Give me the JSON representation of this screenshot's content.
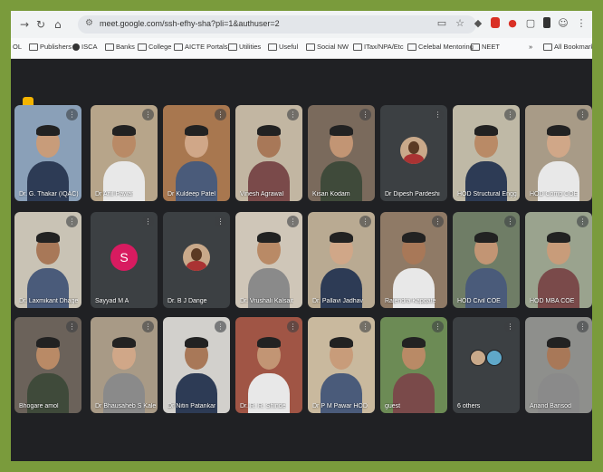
{
  "browser": {
    "url": "meet.google.com/ssh-efhy-sha?pli=1&authuser=2",
    "bookmarks": [
      "Publishers",
      "ISCA",
      "Banks",
      "College",
      "AICTE Portals",
      "Utilities",
      "Useful",
      "Social NW",
      "ITax/NPA/Etc",
      "Celebal Mentoring",
      "NEET"
    ],
    "all_bookmarks_label": "All Bookmarks"
  },
  "meeting": {
    "participants": [
      {
        "name": "Dr. G. Thakar (IQAC)",
        "bg": "#8aa0b8"
      },
      {
        "name": "Dr Anil Pawar",
        "bg": "#b7a58a"
      },
      {
        "name": "Dr Kuldeep Patel",
        "bg": "#a8774f"
      },
      {
        "name": "Vinesh Agrawal",
        "bg": "#c2b6a2"
      },
      {
        "name": "Kisan Kodam",
        "bg": "#7a6a5c"
      },
      {
        "name": "Dr Dipesh Pardeshi",
        "bg": "#3c4043",
        "avatar": "photo"
      },
      {
        "name": "HOD Structural Engg",
        "bg": "#bfb9a6"
      },
      {
        "name": "HOD Comp COE",
        "bg": "#a89b87"
      },
      {
        "name": "Dr. Laxmikant Dhage",
        "bg": "#c9c3b5"
      },
      {
        "name": "Sayyad M A",
        "bg": "#3c4043",
        "avatar": "S",
        "avatar_color": "#d81b60"
      },
      {
        "name": "Dr. B J Dange",
        "bg": "#3c4043",
        "avatar": "photo"
      },
      {
        "name": "Dr. Vrushali Kalsait",
        "bg": "#cfc6b8"
      },
      {
        "name": "Dr. Pallavi Jadhav",
        "bg": "#b9aa92"
      },
      {
        "name": "Rajendra Kapgate",
        "bg": "#8f7a66"
      },
      {
        "name": "HOD Civil COE",
        "bg": "#6f7d66"
      },
      {
        "name": "HOD MBA COE",
        "bg": "#9aa38e"
      },
      {
        "name": "Bhogare amol",
        "bg": "#6b625a"
      },
      {
        "name": "Dr Bhausaheb S Kale",
        "bg": "#a89a86"
      },
      {
        "name": "Dr Nitin Patankar",
        "bg": "#d2d0cc"
      },
      {
        "name": "Dr. R. R. Shinde",
        "bg": "#a05545"
      },
      {
        "name": "Dr P M Pawar HOD",
        "bg": "#c9b99e"
      },
      {
        "name": "guest",
        "bg": "#6c8b55"
      },
      {
        "name": "6 others",
        "bg": "#3c4043",
        "type": "others"
      },
      {
        "name": "Anand Bansod",
        "bg": "#8e8f8c"
      }
    ]
  },
  "colors": {
    "meet_bg": "#202124",
    "tile_bg": "#3c4043",
    "frame": "#7a9b3c",
    "accent": "#f4b400"
  }
}
